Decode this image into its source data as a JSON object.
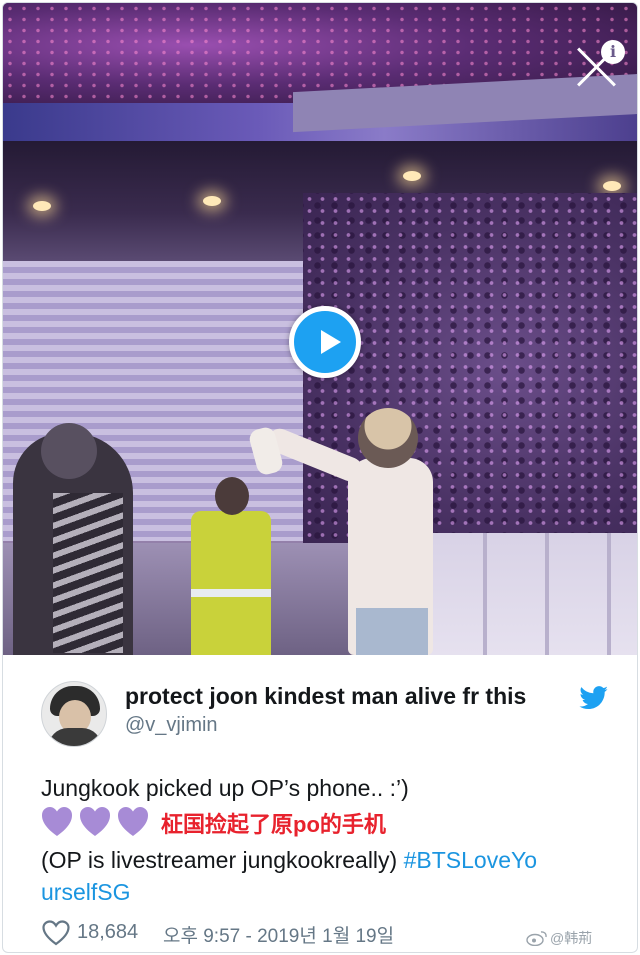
{
  "tweet": {
    "display_name": "protect joon kindest man alive fr this",
    "handle": "@v_vjimin",
    "text_line1": "Jungkook picked up OP’s phone.. :’)",
    "text_chinese": "柾国捡起了原po的手机",
    "text_line3_plain": "(OP is livestreamer jungkookreally) ",
    "hashtag_part1": "#BTSLoveYo",
    "hashtag_part2": "urselfSG",
    "likes": "18,684",
    "timestamp": "오후 9:57 - 2019년 1월 19일"
  },
  "video": {
    "play_icon": "play-icon",
    "close_icon": "close-icon",
    "info_icon": "info-icon",
    "info_glyph": "i"
  },
  "icons": {
    "verified_bird": "twitter-bird-icon",
    "like": "heart-outline-icon",
    "emoji": "purple-heart-emoji"
  },
  "colors": {
    "twitter_blue": "#1da1f2",
    "hashtag_blue": "#1b95e0",
    "muted_gray": "#657786",
    "chinese_text_red": "#e8222d",
    "purple_heart": "#a78bd6"
  },
  "watermark": {
    "text": "@韩荊"
  }
}
